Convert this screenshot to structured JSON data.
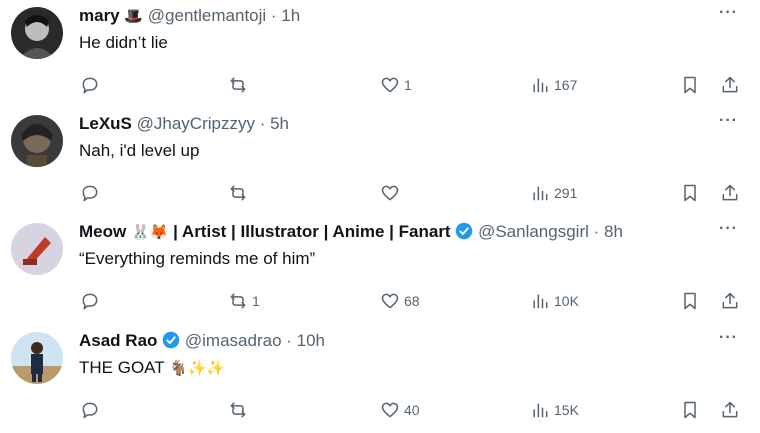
{
  "tweets": [
    {
      "name": "mary",
      "name_emoji": "🎩",
      "handle": "@gentlemantoji",
      "time": "· 1h",
      "text": "He didn’t lie",
      "reply_count": "",
      "retweet_count": "",
      "like_count": "1",
      "view_count": "167",
      "verified": false
    },
    {
      "name": "LeXuS",
      "name_emoji": "",
      "handle": "@JhayCripzzyy",
      "time": "· 5h",
      "text": "Nah, i'd level up",
      "reply_count": "",
      "retweet_count": "",
      "like_count": "",
      "view_count": "291",
      "verified": false
    },
    {
      "name": "Meow",
      "name_emoji": "🐰🦊",
      "name_suffix": "| Artist | Illustrator | Anime | Fanart",
      "handle": "@Sanlangsgirl",
      "time": "· 8h",
      "text": "“Everything reminds me of him”",
      "reply_count": "",
      "retweet_count": "1",
      "like_count": "68",
      "view_count": "10K",
      "verified": true
    },
    {
      "name": "Asad Rao",
      "name_emoji": "",
      "handle": "@imasadrao",
      "time": "· 10h",
      "text": "THE GOAT",
      "text_emoji": "🐐✨✨",
      "reply_count": "",
      "retweet_count": "",
      "like_count": "40",
      "view_count": "15K",
      "verified": true
    }
  ],
  "more_label": "···",
  "colors": {
    "text": "#0f1419",
    "secondary": "#536471",
    "verified": "#1d9bf0"
  },
  "icons": [
    "reply-icon",
    "retweet-icon",
    "like-icon",
    "views-icon",
    "bookmark-icon",
    "share-icon",
    "more-icon",
    "verified-icon"
  ]
}
